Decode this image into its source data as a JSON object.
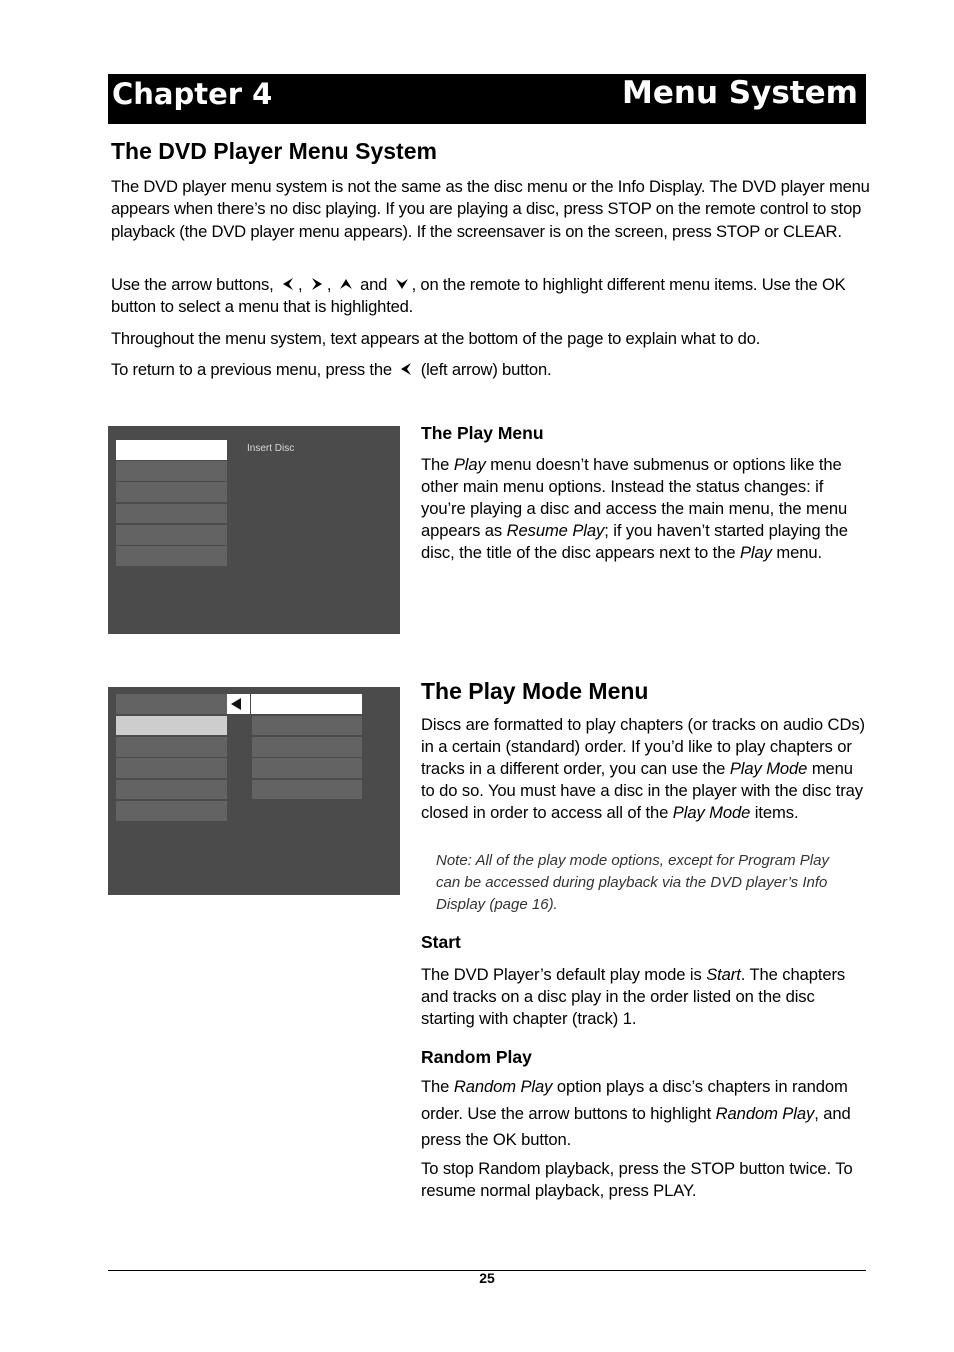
{
  "header": {
    "chapter": "Chapter 4",
    "title": "Menu System"
  },
  "section": {
    "title": "The DVD Player Menu System",
    "paragraphs": {
      "p1": "The DVD player menu system is not the same as the disc menu or the Info Display. The DVD player menu appears when there’s no disc playing. If you are playing a disc, press STOP on the remote control to stop playback (the DVD player menu appears). If the screensaver is on the screen, press STOP or CLEAR.",
      "p2_a": "Use the arrow buttons,",
      "p2_sep1": ",",
      "p2_sep2": ",",
      "p2_and": "and",
      "p2_b": ", on the remote to highlight different menu items. Use the OK button to select a menu that is highlighted.",
      "p3": "Throughout the menu system, text appears at the bottom of the page to explain what to do.",
      "p4_a": "To return to a previous menu, press the",
      "p4_b": "(left arrow) button."
    },
    "arrow_icons": [
      "left-arrow-icon",
      "right-arrow-icon",
      "up-arrow-icon",
      "down-arrow-icon"
    ]
  },
  "play_menu_screen": {
    "status_text": "Insert Disc",
    "menu_items_count": 6,
    "highlighted_index": 0
  },
  "play_menu": {
    "heading": "The Play Menu",
    "body": {
      "t1": "The ",
      "i1": "Play",
      "t2": " menu doesn’t have submenus or options like the other main menu options. Instead the status changes: if you’re playing a disc and access the main menu, the menu appears as ",
      "i2": "Resume Play",
      "t3": "; if you haven’t started playing the disc, the title of the disc appears next to the ",
      "i3": "Play",
      "t4": " menu."
    }
  },
  "play_mode_screen": {
    "main_items_count": 6,
    "sub_items_count": 5,
    "selected_main_index": 1,
    "highlighted_sub_index": 0,
    "back_icon": "left-triangle-icon"
  },
  "play_mode_menu": {
    "heading": "The Play Mode Menu",
    "body": {
      "t1": "Discs are formatted to play chapters (or tracks on audio CDs) in a certain (standard) order. If you’d like to play chapters or tracks in a different order, you can use the ",
      "i1": "Play Mode",
      "t2": " menu to do so. You must have a disc in the player with the disc tray closed in order to access all of the ",
      "i2": "Play Mode",
      "t3": " items."
    },
    "note": "Note: All of the play mode options, except for Program Play can be accessed during playback via the DVD player’s Info Display (page 16)."
  },
  "start": {
    "heading": "Start",
    "body": {
      "t1": "The DVD Player’s default play mode is ",
      "i1": "Start",
      "t2": ". The chapters and tracks on a disc play in the order listed on the disc starting with chapter (track) 1."
    }
  },
  "random_play": {
    "heading": "Random Play",
    "body": {
      "t1": "The ",
      "i1": "Random Play",
      "t2": " option plays a disc’s chapters in random order. Use the arrow buttons to highlight ",
      "i2": "Random Play",
      "t3": ", and press the OK button."
    },
    "body2": "To stop Random playback, press the STOP button twice. To resume normal playback, press PLAY."
  },
  "footer": {
    "page_number": "25"
  }
}
